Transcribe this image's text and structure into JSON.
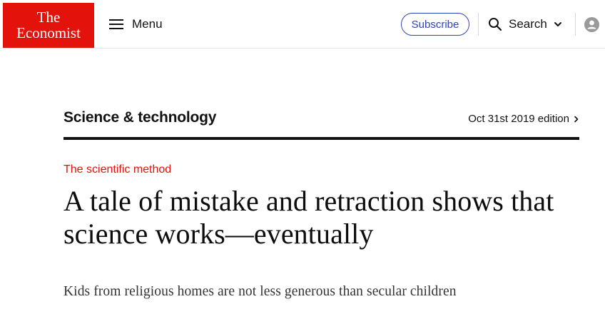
{
  "header": {
    "logo": {
      "line1": "The",
      "line2": "Economist"
    },
    "menu_label": "Menu",
    "subscribe_label": "Subscribe",
    "search_label": "Search"
  },
  "colors": {
    "brand_red": "#e3120b",
    "subscribe_blue": "#2e45b8",
    "text": "#121212"
  },
  "section": {
    "title": "Science & technology",
    "edition": "Oct 31st 2019 edition"
  },
  "article": {
    "rubric": "The scientific method",
    "headline": "A tale of mistake and retraction shows that science works—eventually",
    "standfirst": "Kids from religious homes are not less generous than secular children"
  }
}
